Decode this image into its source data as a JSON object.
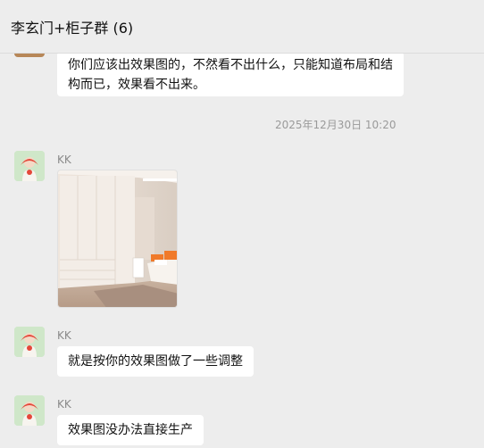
{
  "window": {
    "title": "李玄门+柜子群 (6)"
  },
  "messages": [
    {
      "type": "text",
      "sender": "",
      "text": "你们应该出效果图的，不然看不出什么，只能知道布局和结构而已，效果看不出来。"
    },
    {
      "type": "timestamp",
      "text": "2025年12月30日 10:20"
    },
    {
      "type": "image",
      "sender": "KK",
      "image_icon": "room-wardrobe-render-image"
    },
    {
      "type": "text",
      "sender": "KK",
      "text": "就是按你的效果图做了一些调整"
    },
    {
      "type": "text",
      "sender": "KK",
      "text": "效果图没办法直接生产"
    }
  ],
  "colors": {
    "background": "#ededed",
    "bubble": "#ffffff",
    "avatar_bg": "#cfe7c9",
    "accent_orange": "#f07a2a"
  }
}
